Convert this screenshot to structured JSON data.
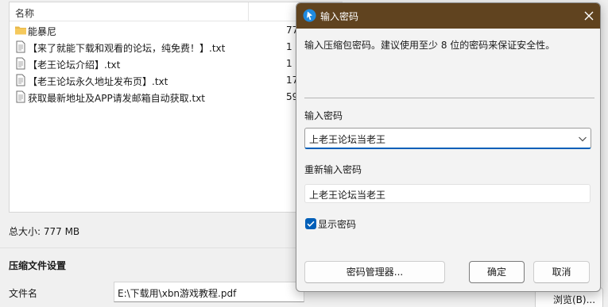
{
  "archive_window": {
    "column_name": "名称",
    "files": [
      {
        "name": "能暴尼",
        "size": "77",
        "type": "folder"
      },
      {
        "name": "【来了就能下载和观看的论坛，纯免费！】.txt",
        "size": "1",
        "type": "txt"
      },
      {
        "name": "【老王论坛介绍】.txt",
        "size": "1",
        "type": "txt"
      },
      {
        "name": "【老王论坛永久地址发布页】.txt",
        "size": "17",
        "type": "txt"
      },
      {
        "name": "获取最新地址及APP请发邮箱自动获取.txt",
        "size": "59",
        "type": "txt"
      }
    ],
    "total_size": "总大小: 777 MB",
    "settings_title": "压缩文件设置",
    "filename_label": "文件名",
    "filename_value": "E:\\下载用\\xbn游戏教程.pdf",
    "browse_label": "浏览(B)..."
  },
  "dialog": {
    "title": "输入密码",
    "intro": "输入压缩包密码。建议使用至少 8 位的密码来保证安全性。",
    "password_label": "输入密码",
    "password_value": "上老王论坛当老王",
    "reenter_label": "重新输入密码",
    "reenter_value": "上老王论坛当老王",
    "show_password_label": "显示密码",
    "show_password_checked": true,
    "buttons": {
      "manager": "密码管理器...",
      "ok": "确定",
      "cancel": "取消"
    }
  },
  "icons": {
    "folder": "folder-icon",
    "text_file": "text-file-icon",
    "app": "bandizip-icon",
    "close": "close-icon",
    "chevron": "chevron-down-icon",
    "check": "check-icon"
  },
  "colors": {
    "titlebar": "#60431f",
    "accent": "#005fb8",
    "folder": "#e8b84a"
  }
}
